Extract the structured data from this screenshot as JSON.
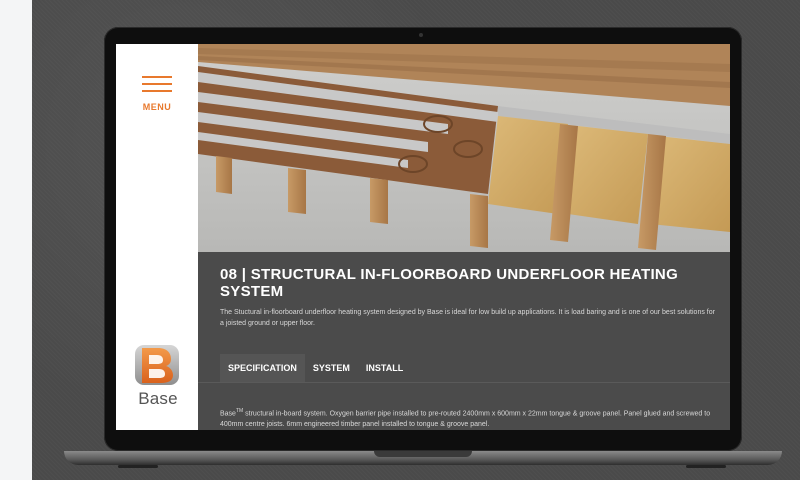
{
  "sidebar": {
    "menu_label": "MENU",
    "logo_text": "Base"
  },
  "product": {
    "title": "08 | STRUCTURAL IN-FLOORBOARD UNDERFLOOR HEATING SYSTEM",
    "description": "The Stuctural in-floorboard underfloor heating system designed by Base is ideal for low build up applications. It is load baring and is one of our best solutions for a joisted ground or upper floor."
  },
  "tabs": [
    {
      "label": "SPECIFICATION",
      "active": true
    },
    {
      "label": "SYSTEM",
      "active": false
    },
    {
      "label": "INSTALL",
      "active": false
    }
  ],
  "specification": {
    "brand": "Base",
    "trademark": "TM",
    "text": " structural in-board system. Oxygen barrier pipe installed to pre-routed 2400mm x 600mm x 22mm tongue & groove panel. Panel glued and screwed to 400mm centre joists. 6mm engineered timber panel installed to tongue & groove panel."
  },
  "colors": {
    "accent": "#e8792d",
    "content_bg": "#4b4b4b",
    "sidebar_bg": "#ffffff"
  }
}
